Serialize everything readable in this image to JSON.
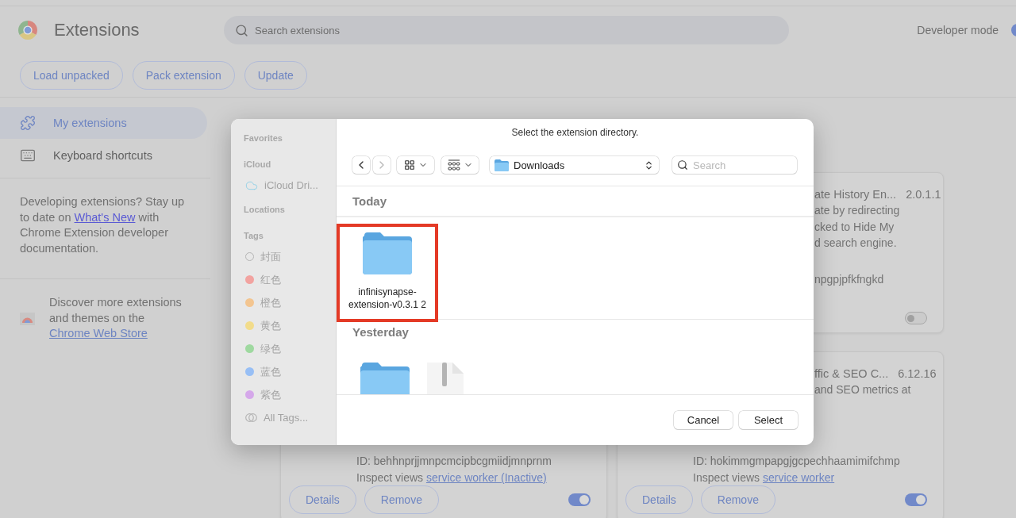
{
  "header": {
    "title": "Extensions",
    "search": {
      "placeholder": "Search extensions"
    },
    "developer_mode": {
      "label": "Developer mode",
      "on": true
    }
  },
  "toolbar": {
    "buttons": [
      "Load unpacked",
      "Pack extension",
      "Update"
    ]
  },
  "sidebar": {
    "items": [
      {
        "label": "My extensions",
        "kind": "puzzle",
        "selected": true
      },
      {
        "label": "Keyboard shortcuts",
        "kind": "keyboard",
        "selected": false
      }
    ],
    "note": {
      "before": "Developing extensions? Stay up to date on ",
      "link": "What's New",
      "after": " with Chrome Extension developer documentation."
    },
    "discover": {
      "before": "Discover more extensions and themes on the ",
      "link": "Chrome Web Store"
    }
  },
  "cards": [
    {
      "title": "ate History En...",
      "version": "2.0.1.1",
      "description": [
        "ate by redirecting",
        "cked to Hide My",
        "d search engine."
      ],
      "id_fragment": "npgpjpfkfngkd",
      "enabled": false
    },
    {
      "id_line": "ID: behhnprjjmnpcmcipbcgmiidjmnprnm",
      "inspect": {
        "label": "Inspect views",
        "link": "service worker (Inactive)"
      },
      "buttons": [
        "Details",
        "Remove"
      ],
      "enabled": true
    },
    {
      "title": "ffic & SEO C...",
      "version": "6.12.16",
      "description": [
        "and SEO metrics at"
      ],
      "id_line": "ID: hokimmgmpapgjgcpechhaamimifchmp",
      "inspect": {
        "label": "Inspect views",
        "link": "service worker"
      },
      "buttons": [
        "Details",
        "Remove"
      ],
      "enabled": true
    }
  ],
  "dialog": {
    "message": "Select the extension directory.",
    "sidebar": [
      {
        "title": "Favorites"
      },
      {
        "title": "iCloud",
        "items": [
          {
            "label": "iCloud Dri...",
            "kind": "cloud"
          }
        ]
      },
      {
        "title": "Locations"
      },
      {
        "title": "Tags",
        "items": [
          {
            "label": "封面",
            "kind": "untagged"
          },
          {
            "label": "红色",
            "kind": "tag",
            "color": "#f2a3a0"
          },
          {
            "label": "橙色",
            "kind": "tag",
            "color": "#f3c590"
          },
          {
            "label": "黄色",
            "kind": "tag",
            "color": "#f2dc8b"
          },
          {
            "label": "绿色",
            "kind": "tag",
            "color": "#9fd9a0"
          },
          {
            "label": "蓝色",
            "kind": "tag",
            "color": "#98bff5"
          },
          {
            "label": "紫色",
            "kind": "tag",
            "color": "#d5a8ea"
          },
          {
            "label": "All Tags...",
            "kind": "all"
          }
        ]
      }
    ],
    "nav": [
      {
        "kind": "back",
        "disabled": false
      },
      {
        "kind": "forward",
        "disabled": true
      }
    ],
    "location": "Downloads",
    "search": {
      "placeholder": "Search"
    },
    "groups": [
      {
        "title": "Today",
        "items": [
          {
            "name": "infinisynapse-extension-v0.3.1 2",
            "kind": "folder",
            "highlighted": true
          }
        ]
      },
      {
        "title": "Yesterday",
        "items": [
          {
            "kind": "folder",
            "highlighted": false
          },
          {
            "kind": "zip",
            "highlighted": false
          }
        ]
      }
    ],
    "buttons": [
      "Cancel",
      "Select"
    ]
  }
}
